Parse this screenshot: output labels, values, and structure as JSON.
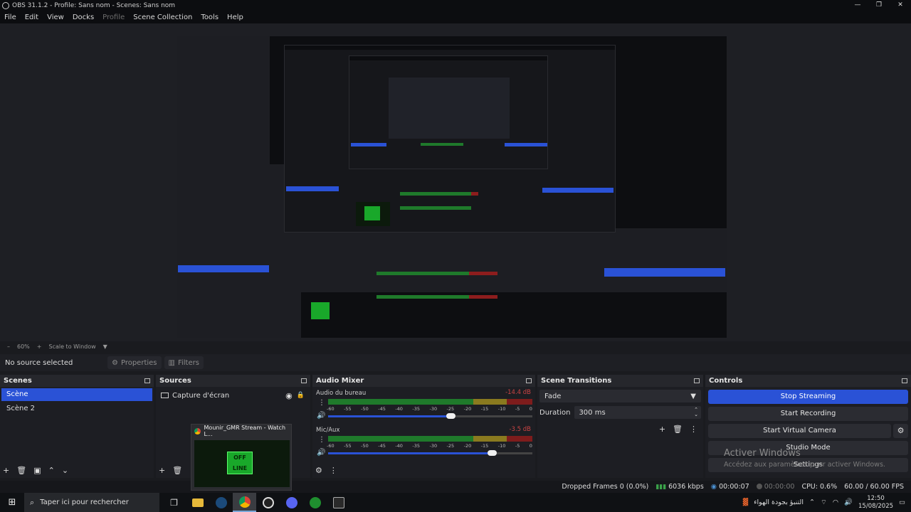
{
  "window": {
    "title": "OBS 31.1.2 - Profile: Sans nom - Scenes: Sans nom",
    "controls": [
      "—",
      "❐",
      "✕"
    ]
  },
  "menu": [
    "File",
    "Edit",
    "View",
    "Docks",
    "Profile",
    "Scene Collection",
    "Tools",
    "Help"
  ],
  "zoom": {
    "percent": "60%",
    "scale_label": "Scale to Window"
  },
  "source_toolbar": {
    "no_source": "No source selected",
    "properties": "Properties",
    "filters": "Filters"
  },
  "scenes": {
    "title": "Scenes",
    "items": [
      "Scène",
      "Scène 2"
    ]
  },
  "sources": {
    "title": "Sources",
    "items": [
      "Capture d'écran"
    ]
  },
  "audio_mixer": {
    "title": "Audio Mixer",
    "ticks": [
      "-60",
      "-55",
      "-50",
      "-45",
      "-40",
      "-35",
      "-30",
      "-25",
      "-20",
      "-15",
      "-10",
      "-5",
      "0"
    ],
    "channels": [
      {
        "name": "Audio du bureau",
        "db": "-14.4 dB",
        "volume": 0.6
      },
      {
        "name": "Mic/Aux",
        "db": "-3.5 dB",
        "volume": 0.8
      }
    ]
  },
  "transitions": {
    "title": "Scene Transitions",
    "selected": "Fade",
    "duration_label": "Duration",
    "duration_value": "300 ms"
  },
  "controls": {
    "title": "Controls",
    "stop_streaming": "Stop Streaming",
    "start_recording": "Start Recording",
    "start_virtual_camera": "Start Virtual Camera",
    "studio_mode": "Studio Mode",
    "settings": "Settings"
  },
  "watermark": {
    "line1": "Activer Windows",
    "line2": "Accédez aux paramètres pour activer Windows."
  },
  "status": {
    "dropped": "Dropped Frames 0 (0.0%)",
    "bitrate": "6036 kbps",
    "stream_time": "00:00:07",
    "rec_time": "00:00:00",
    "cpu": "CPU: 0.6%",
    "fps": "60.00 / 60.00 FPS"
  },
  "popup": {
    "title": "Mounir_GMR Stream - Watch L...",
    "thumb_text_1": "OFF",
    "thumb_text_2": "LINE"
  },
  "taskbar": {
    "search_placeholder": "Taper ici pour rechercher",
    "weather": "التنبؤ بجودة الهواء",
    "time": "12:50",
    "date": "15/08/2025"
  }
}
